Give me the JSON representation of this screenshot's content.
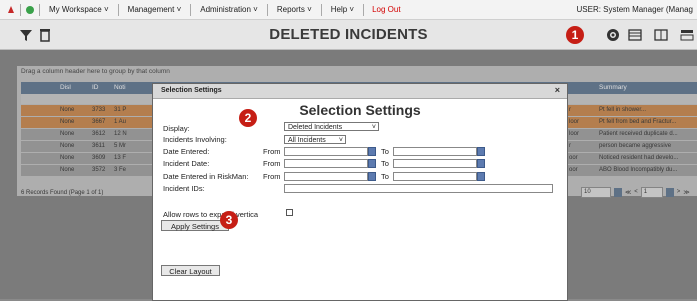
{
  "topbar": {
    "menus": [
      "My Workspace ˅",
      "Management ˅",
      "Administration ˅",
      "Reports ˅",
      "Help ˅"
    ],
    "logout": "Log Out",
    "user": "USER: System Manager (Manag"
  },
  "page": {
    "title": "DELETED INCIDENTS"
  },
  "grid": {
    "group_hint": "Drag a column header here to group by that column",
    "headers": {
      "disl": "Disl",
      "id": "ID",
      "notif": "Noti",
      "summary": "Summary"
    },
    "rows": [
      {
        "disl": "None",
        "id": "3733",
        "notif": "31 P",
        "loc": "r",
        "summary": "Pt fell in shower..."
      },
      {
        "disl": "None",
        "id": "3667",
        "notif": "1 Au",
        "loc": "loor",
        "summary": "Pt fell from bed and Fractur..."
      },
      {
        "disl": "None",
        "id": "3612",
        "notif": "12 N",
        "loc": "loor",
        "summary": "Patient received duplicate d..."
      },
      {
        "disl": "None",
        "id": "3611",
        "notif": "5 Mr",
        "loc": "r",
        "summary": "person became aggressive"
      },
      {
        "disl": "None",
        "id": "3609",
        "notif": "13 F",
        "loc": "oor",
        "summary": "Noticed resident had develo..."
      },
      {
        "disl": "None",
        "id": "3572",
        "notif": "3 Fe",
        "loc": "oor",
        "summary": "ABO Blood Incompatibly du..."
      }
    ],
    "footer": "6 Records Found (Page 1 of 1)",
    "page_size": "10",
    "page_num": "1"
  },
  "modal": {
    "title": "Selection Settings",
    "close": "×",
    "heading": "Selection Settings",
    "display_label": "Display:",
    "display_value": "Deleted Incidents",
    "involving_label": "Incidents Involving:",
    "involving_value": "All Incidents",
    "date_entered_label": "Date Entered:",
    "incident_date_label": "Incident Date:",
    "riskman_label": "Date Entered in RiskMan:",
    "ids_label": "Incident IDs:",
    "from": "From",
    "to": "To",
    "expand_label": "Allow rows to expand vertica",
    "apply": "Apply Settings",
    "clear": "Clear Layout"
  },
  "badges": [
    "1",
    "2",
    "3"
  ],
  "colors": {
    "badge": "#c61e15",
    "row_highlight": "#c7803f",
    "header": "#556e8a"
  }
}
